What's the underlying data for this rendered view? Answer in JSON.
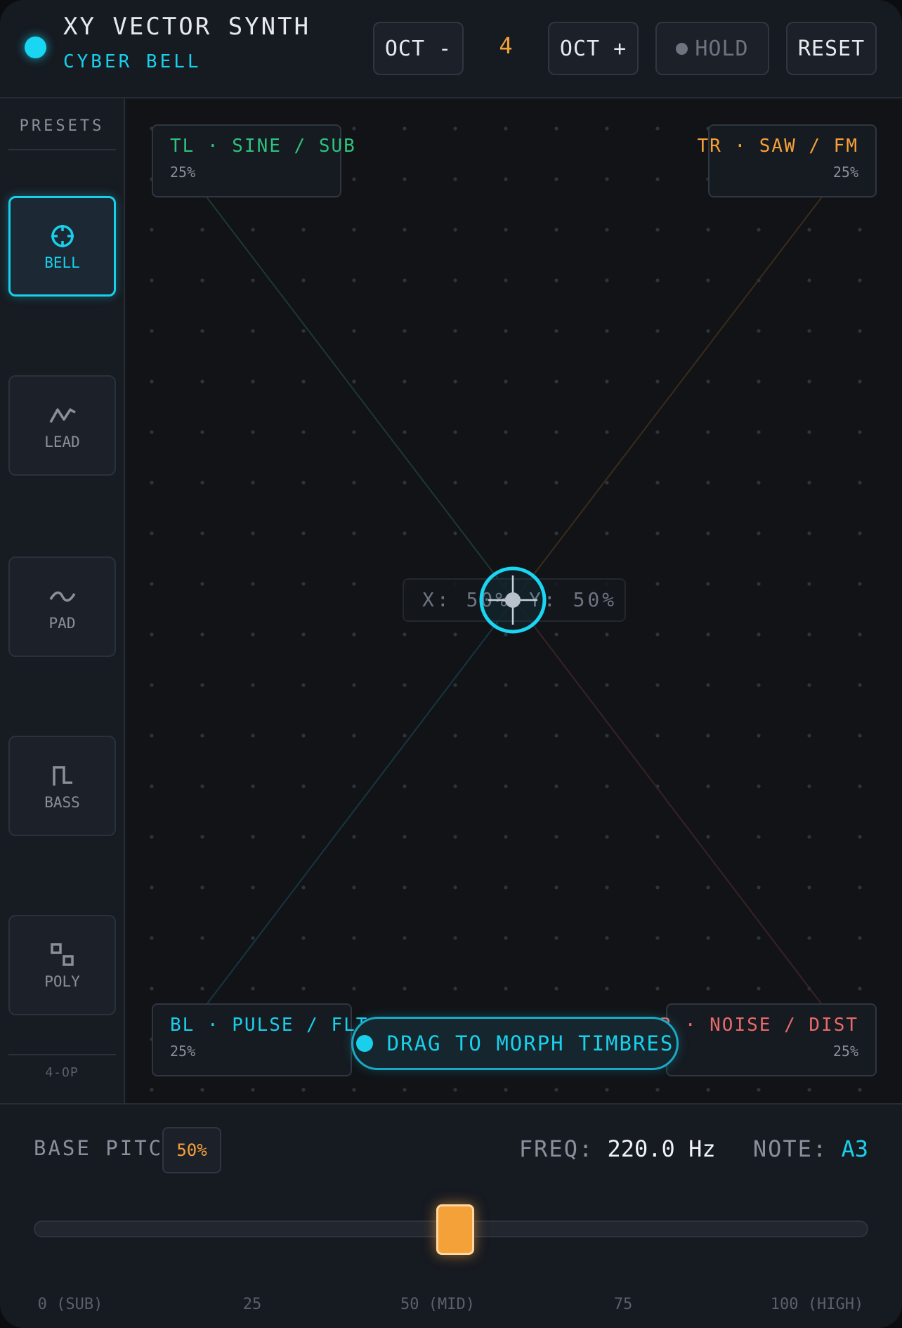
{
  "header": {
    "title": "XY VECTOR SYNTH",
    "preset_name": "CYBER BELL",
    "oct_minus_label": "OCT -",
    "octave_value": "4",
    "oct_plus_label": "OCT +",
    "hold_label": "HOLD",
    "reset_label": "RESET"
  },
  "sidebar": {
    "title": "PRESETS",
    "items": [
      {
        "label": "BELL",
        "icon": "crosshair-icon",
        "active": true
      },
      {
        "label": "LEAD",
        "icon": "zigzag-icon",
        "active": false
      },
      {
        "label": "PAD",
        "icon": "wave-icon",
        "active": false
      },
      {
        "label": "BASS",
        "icon": "square-wave-icon",
        "active": false
      },
      {
        "label": "POLY",
        "icon": "stacked-squares-icon",
        "active": false
      }
    ],
    "footer": "4-OP"
  },
  "pad": {
    "corners": {
      "tl": {
        "label": "TL · SINE / SUB",
        "mix": "25%",
        "color": "#2ec27e"
      },
      "tr": {
        "label": "TR · SAW / FM",
        "mix": "25%",
        "color": "#f5a13a"
      },
      "bl": {
        "label": "BL · PULSE / FLT",
        "mix": "25%",
        "color": "#19d0ec"
      },
      "br": {
        "label": "BR · NOISE / DIST",
        "mix": "25%",
        "color": "#e86a6a"
      }
    },
    "readout_x": "X: 50%",
    "readout_y": "Y: 50%",
    "x_value": 0.5,
    "y_value": 0.5,
    "hint": "DRAG TO MORPH TIMBRES"
  },
  "pitch": {
    "label": "BASE PITCH",
    "value_badge": "50%",
    "value": 0.5,
    "freq_key": "FREQ:",
    "freq_value": "220.0 Hz",
    "note_key": "NOTE:",
    "note_value": "A3",
    "ticks": [
      "0 (SUB)",
      "25",
      "50 (MID)",
      "75",
      "100 (HIGH)"
    ]
  },
  "colors": {
    "accent": "#19d0ec",
    "orange": "#f5a13a",
    "background": "#13161c"
  }
}
